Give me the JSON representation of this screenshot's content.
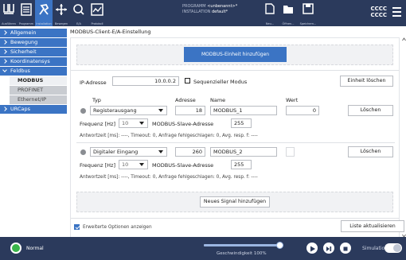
{
  "topbar": {
    "items": [
      {
        "label": "Ausführen"
      },
      {
        "label": "Programm"
      },
      {
        "label": "Installation"
      },
      {
        "label": "Bewegen"
      },
      {
        "label": "E/A"
      },
      {
        "label": "Protokoll"
      }
    ],
    "program_label": "PROGRAMM",
    "program_value": "<unbenannt>*",
    "installation_label": "INSTALLATION",
    "installation_value": "default*",
    "file_actions": [
      {
        "label": "Neu..."
      },
      {
        "label": "Öffnen..."
      },
      {
        "label": "Speichern..."
      }
    ],
    "user_line1": "CCCC",
    "user_line2": "CCCC"
  },
  "sidebar": {
    "items": [
      {
        "label": "Allgemein"
      },
      {
        "label": "Bewegung"
      },
      {
        "label": "Sicherheit"
      },
      {
        "label": "Koordinatensys"
      },
      {
        "label": "Feldbus"
      }
    ],
    "subitems": [
      {
        "label": "MODBUS"
      },
      {
        "label": "PROFINET"
      },
      {
        "label": "Ethernet/IP"
      }
    ],
    "urcaps": "URCaps"
  },
  "main": {
    "title": "MODBUS-Client-E/A-Einstellung",
    "add_unit": "MODBUS-Einheit hinzufügen",
    "ip_label": "IP-Adresse",
    "ip_value": "10.0.0.2",
    "seq_mode": "Sequenzieller Modus",
    "delete_unit": "Einheit löschen",
    "col_type": "Typ",
    "col_address": "Adresse",
    "col_name": "Name",
    "col_value": "Wert",
    "signals": [
      {
        "type": "Registerausgang",
        "address": "18",
        "name": "MODBUS_1",
        "value": "0",
        "delete": "Löschen",
        "freq_label": "Frequenz [Hz]",
        "freq": "10",
        "slave_label": "MODBUS-Slave-Adresse",
        "slave": "255",
        "stats": "Antwortzeit [ms]: ----,   Timeout:   0,   Anfrage fehlgeschlagen:   0,   Avg. resp. f: ----"
      },
      {
        "type": "Digitaler Eingang",
        "address": "260",
        "name": "MODBUS_2",
        "value": "",
        "delete": "Löschen",
        "freq_label": "Frequenz [Hz]",
        "freq": "10",
        "slave_label": "MODBUS-Slave-Adresse",
        "slave": "255",
        "stats": "Antwortzeit [ms]: ----,   Timeout:   0,   Anfrage fehlgeschlagen:   0,   Avg. resp. f: ----"
      }
    ],
    "add_signal": "Neues Signal hinzufügen",
    "advanced": "Erweiterte Optionen anzeigen",
    "refresh": "Liste aktualisieren"
  },
  "bottombar": {
    "status": "Normal",
    "speed_label": "Geschwindigkeit 100%",
    "speed_fraction": 1.0,
    "simulation": "Simulation"
  }
}
